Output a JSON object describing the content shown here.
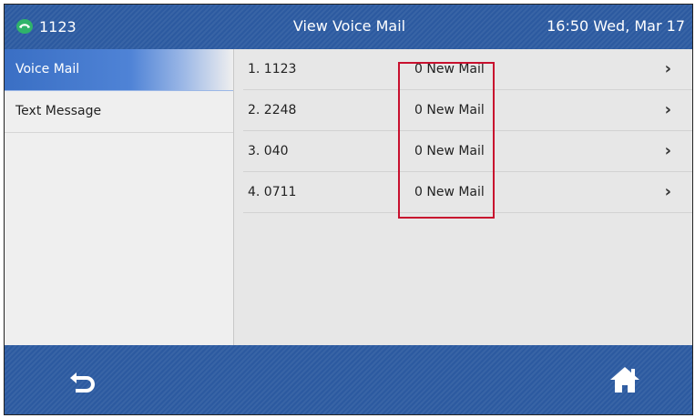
{
  "header": {
    "line_label": "1123",
    "title": "View Voice Mail",
    "datetime": "16:50  Wed, Mar 17"
  },
  "sidebar": {
    "items": [
      {
        "label": "Voice Mail",
        "active": true
      },
      {
        "label": "Text Message",
        "active": false
      }
    ]
  },
  "voicemail": {
    "rows": [
      {
        "number": "1. 1123",
        "status": "0 New Mail"
      },
      {
        "number": "2. 2248",
        "status": "0 New Mail"
      },
      {
        "number": "3. 040",
        "status": "0 New Mail"
      },
      {
        "number": "4. 0711",
        "status": "0 New Mail"
      }
    ]
  },
  "footer": {
    "back_icon": "back-arrow-icon",
    "home_icon": "home-icon"
  },
  "colors": {
    "bar_blue": "#2c5aa0",
    "active_blue": "#3a6fc4",
    "highlight_red": "#c8102e",
    "phone_green": "#2fb36a"
  }
}
